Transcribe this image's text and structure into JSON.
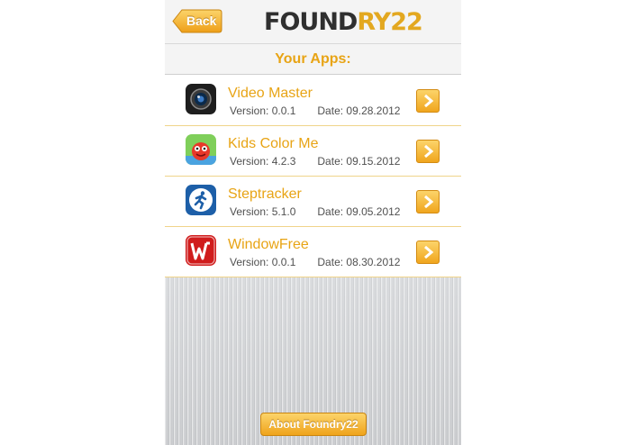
{
  "header": {
    "back_label": "Back",
    "logo_dark": "FOUND",
    "logo_gold": "RY22"
  },
  "section": {
    "title": "Your Apps:"
  },
  "apps": [
    {
      "name": "Video Master",
      "version": "Version: 0.0.1",
      "date": "Date: 09.28.2012",
      "icon": "camera-lens-icon"
    },
    {
      "name": "Kids Color Me",
      "version": "Version: 4.2.3",
      "date": "Date: 09.15.2012",
      "icon": "cartoon-character-icon"
    },
    {
      "name": "Steptracker",
      "version": "Version: 5.1.0",
      "date": "Date: 09.05.2012",
      "icon": "running-man-icon"
    },
    {
      "name": "WindowFree",
      "version": "Version: 0.0.1",
      "date": "Date: 08.30.2012",
      "icon": "w-letter-icon"
    }
  ],
  "footer": {
    "about_label": "About Foundry22"
  },
  "colors": {
    "accent": "#e8a415",
    "button_top": "#fcd46a",
    "button_bottom": "#efa31b"
  }
}
